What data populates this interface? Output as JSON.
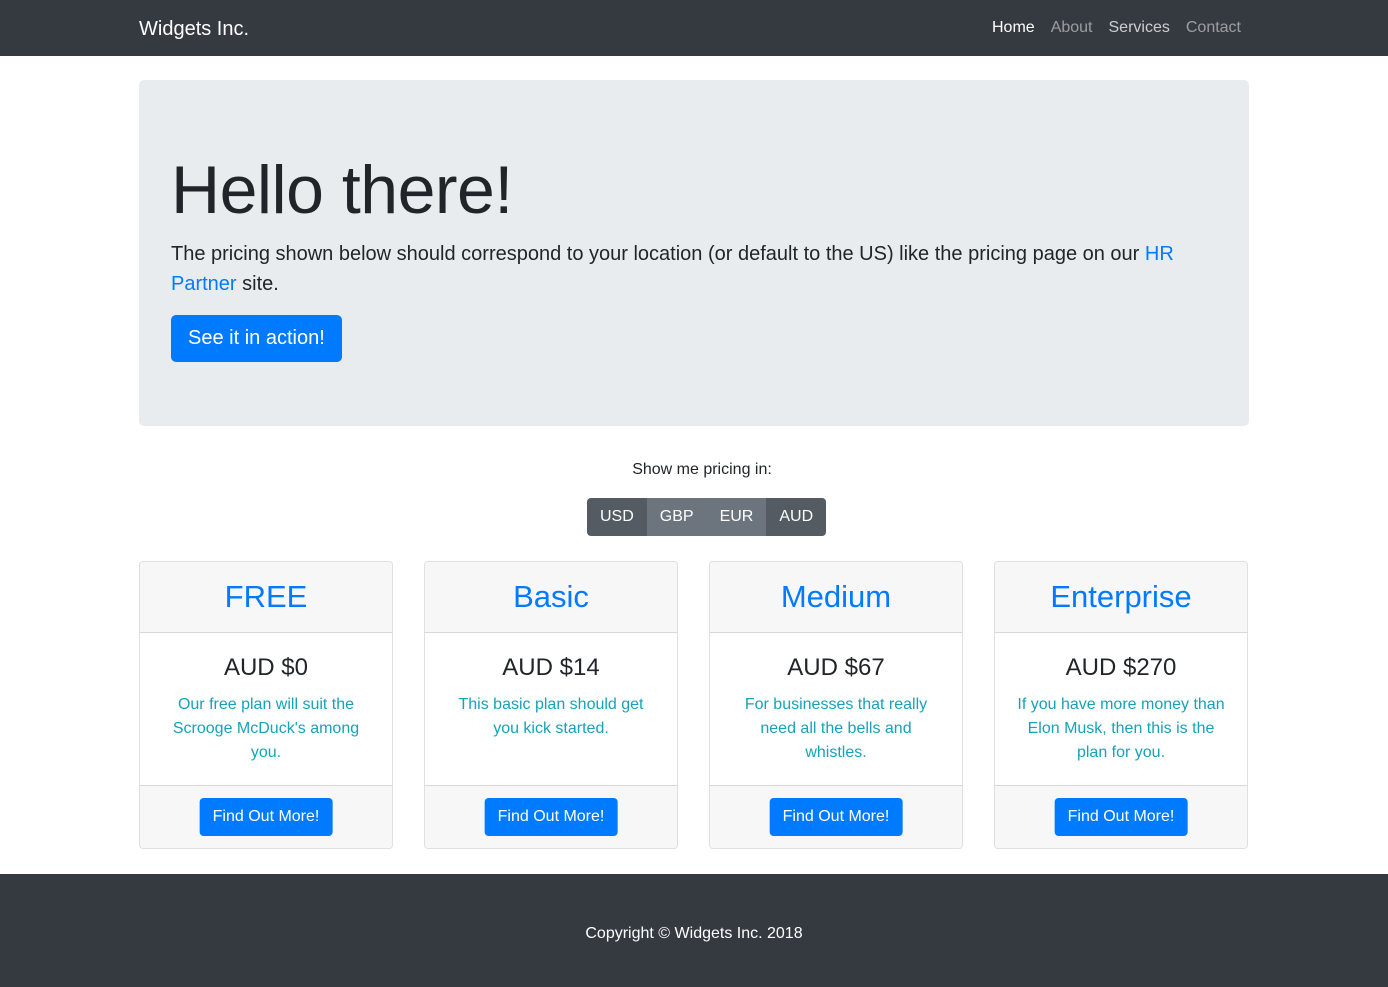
{
  "navbar": {
    "brand": "Widgets Inc.",
    "links": [
      {
        "label": "Home"
      },
      {
        "label": "About"
      },
      {
        "label": "Services"
      },
      {
        "label": "Contact"
      }
    ]
  },
  "hero": {
    "title": "Hello there!",
    "lead_text": "The pricing shown below should correspond to your location (or default to the US) like the pricing page on our ",
    "lead_link": "HR Partner",
    "lead_suffix": " site.",
    "cta_label": "See it in action!"
  },
  "pricing": {
    "label": "Show me pricing in:",
    "currencies": [
      "USD",
      "GBP",
      "EUR",
      "AUD"
    ],
    "selected_currency": "AUD"
  },
  "plans": [
    {
      "name": "FREE",
      "price": "AUD $0",
      "description": "Our free plan will suit the Scrooge McDuck's among you.",
      "button": "Find Out More!"
    },
    {
      "name": "Basic",
      "price": "AUD $14",
      "description": "This basic plan should get you kick started.",
      "button": "Find Out More!"
    },
    {
      "name": "Medium",
      "price": "AUD $67",
      "description": "For businesses that really need all the bells and whistles.",
      "button": "Find Out More!"
    },
    {
      "name": "Enterprise",
      "price": "AUD $270",
      "description": "If you have more money than Elon Musk, then this is the plan for you.",
      "button": "Find Out More!"
    }
  ],
  "footer": {
    "copyright": "Copyright © Widgets Inc. 2018"
  },
  "colors": {
    "navbar_bg": "#343a40",
    "primary": "#007bff",
    "info_text": "#17a2b8",
    "jumbotron_bg": "#e9ecef",
    "secondary_btn": "#6c757d"
  }
}
